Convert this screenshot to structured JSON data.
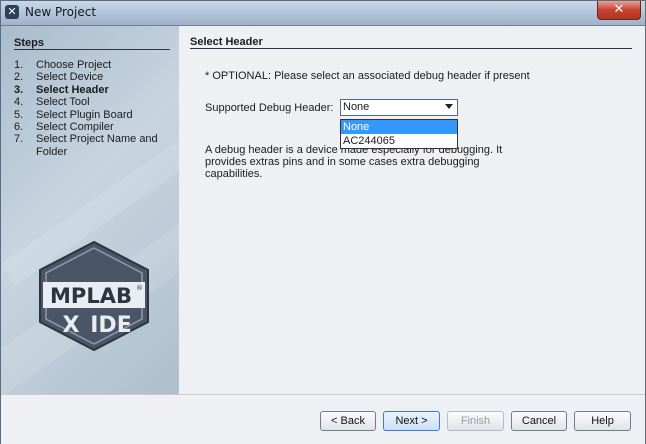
{
  "window": {
    "title": "New Project",
    "close_glyph": "✕",
    "app_icon": "mplab-x-icon"
  },
  "steps": {
    "title": "Steps",
    "items": [
      {
        "num": "1.",
        "label": "Choose Project",
        "active": false
      },
      {
        "num": "2.",
        "label": "Select Device",
        "active": false
      },
      {
        "num": "3.",
        "label": "Select Header",
        "active": true
      },
      {
        "num": "4.",
        "label": "Select Tool",
        "active": false
      },
      {
        "num": "5.",
        "label": "Select Plugin Board",
        "active": false
      },
      {
        "num": "6.",
        "label": "Select Compiler",
        "active": false
      },
      {
        "num": "7.",
        "label": "Select Project Name and Folder",
        "active": false
      }
    ]
  },
  "logo": {
    "line1": "MPLAB",
    "reg": "®",
    "line2_x": "X",
    "line2_ide": "IDE"
  },
  "content": {
    "title": "Select Header",
    "optional_text": "* OPTIONAL: Please select an associated debug header if present",
    "field_label": "Supported Debug Header:",
    "select_value": "None",
    "dropdown_options": [
      "None",
      "AC244065"
    ],
    "description": "A debug header is a device made especially for debugging. It provides extras pins and in some cases extra debugging capabilities."
  },
  "buttons": {
    "back": "< Back",
    "next": "Next >",
    "finish": "Finish",
    "cancel": "Cancel",
    "help": "Help"
  },
  "colors": {
    "accent": "#3399ff",
    "titlebar": "#b4c4d8",
    "close": "#c7422f"
  }
}
